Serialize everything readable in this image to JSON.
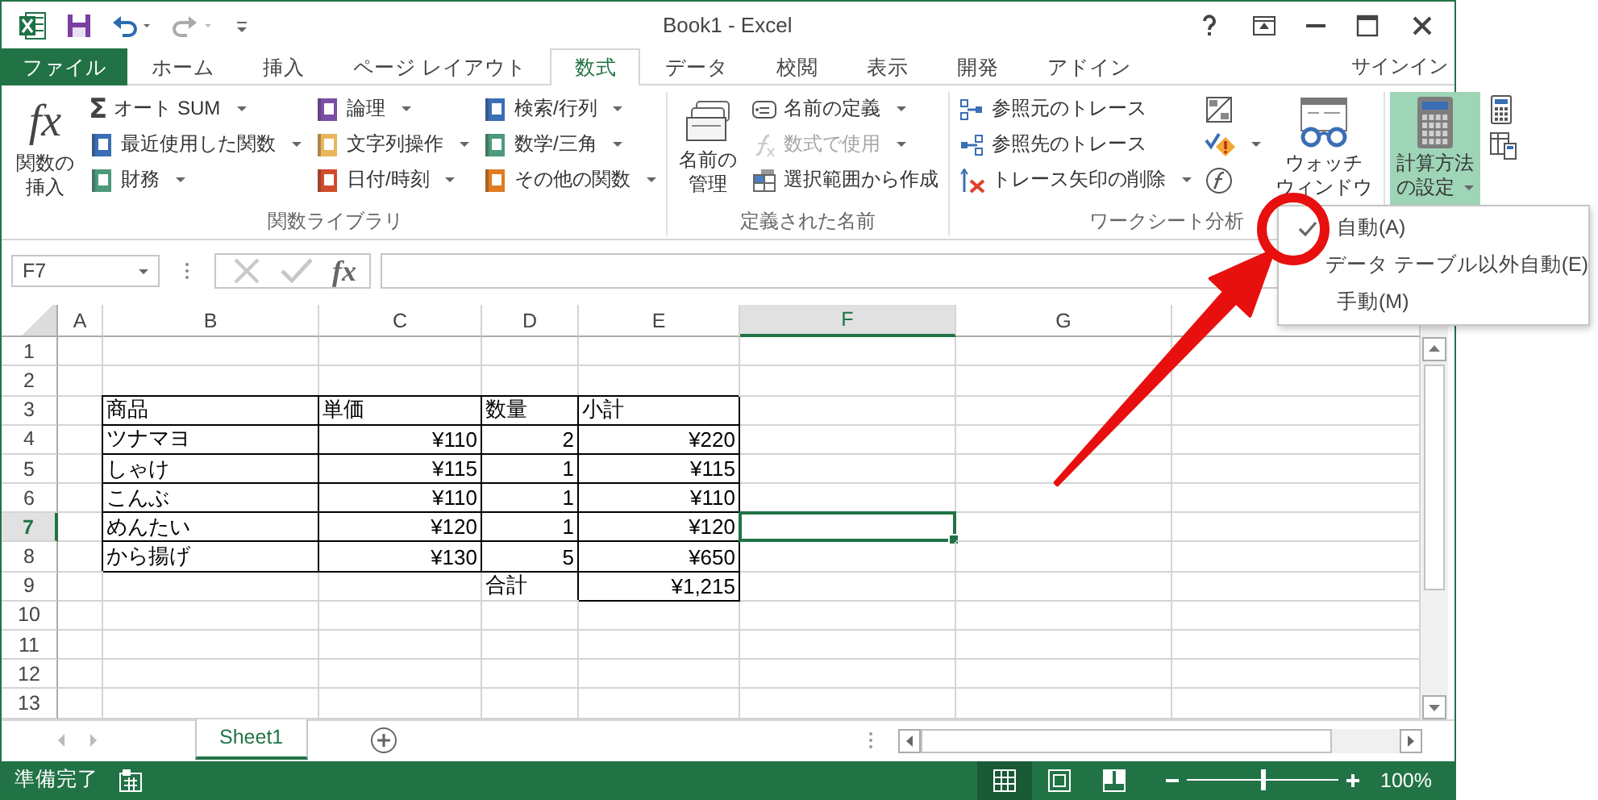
{
  "window": {
    "title": "Book1 - Excel"
  },
  "tabs": [
    {
      "label": "ファイル",
      "kind": "file",
      "selected": false
    },
    {
      "label": "ホーム",
      "kind": "tab",
      "selected": false
    },
    {
      "label": "挿入",
      "kind": "tab",
      "selected": false
    },
    {
      "label": "ページ レイアウト",
      "kind": "tab",
      "selected": false
    },
    {
      "label": "数式",
      "kind": "tab",
      "selected": true
    },
    {
      "label": "データ",
      "kind": "tab",
      "selected": false
    },
    {
      "label": "校閲",
      "kind": "tab",
      "selected": false
    },
    {
      "label": "表示",
      "kind": "tab",
      "selected": false
    },
    {
      "label": "開発",
      "kind": "tab",
      "selected": false
    },
    {
      "label": "アドイン",
      "kind": "tab",
      "selected": false
    }
  ],
  "account": {
    "label": "サインイン"
  },
  "ribbon_groups": [
    {
      "label": "関数ライブラリ",
      "columns": [
        [
          {
            "kind": "large",
            "glyph": "fx",
            "lines": [
              "関数の",
              "挿入"
            ],
            "dropdown": false,
            "disabled": false,
            "pressed": false
          }
        ],
        [
          {
            "kind": "small",
            "glyph": "Σ",
            "label": "オート SUM",
            "dropdown": true,
            "disabled": false
          },
          {
            "kind": "small",
            "label": "最近使用した関数",
            "dropdown": true,
            "disabled": false
          },
          {
            "kind": "small",
            "label": "財務",
            "dropdown": true,
            "disabled": false
          }
        ],
        [
          {
            "kind": "small",
            "label": "論理",
            "dropdown": true,
            "disabled": false
          },
          {
            "kind": "small",
            "label": "文字列操作",
            "dropdown": true,
            "disabled": false
          },
          {
            "kind": "small",
            "label": "日付/時刻",
            "dropdown": true,
            "disabled": false
          }
        ],
        [
          {
            "kind": "small",
            "label": "検索/行列",
            "dropdown": true,
            "disabled": false
          },
          {
            "kind": "small",
            "label": "数学/三角",
            "dropdown": true,
            "disabled": false
          },
          {
            "kind": "small",
            "label": "その他の関数",
            "dropdown": true,
            "disabled": false
          }
        ]
      ]
    },
    {
      "label": "定義された名前",
      "columns": [
        [
          {
            "kind": "large",
            "lines": [
              "名前の",
              "管理"
            ],
            "dropdown": false,
            "disabled": false,
            "pressed": false
          }
        ],
        [
          {
            "kind": "small",
            "label": "名前の定義",
            "dropdown": true,
            "disabled": false
          },
          {
            "kind": "small",
            "label": "数式で使用",
            "dropdown": true,
            "disabled": true
          },
          {
            "kind": "small",
            "label": "選択範囲から作成",
            "dropdown": false,
            "disabled": false
          }
        ]
      ]
    },
    {
      "label": "ワークシート分析",
      "columns": [
        [
          {
            "kind": "small",
            "label": "参照元のトレース",
            "dropdown": false,
            "disabled": false
          },
          {
            "kind": "small",
            "label": "参照先のトレース",
            "dropdown": false,
            "disabled": false
          },
          {
            "kind": "small",
            "label": "トレース矢印の削除",
            "dropdown": true,
            "disabled": false
          }
        ],
        [
          {
            "kind": "icon",
            "dropdown": false,
            "disabled": false
          },
          {
            "kind": "icon",
            "dropdown": true,
            "disabled": false
          },
          {
            "kind": "icon",
            "dropdown": false,
            "disabled": false
          }
        ],
        [
          {
            "kind": "large",
            "lines": [
              "ウォッチ",
              "ウィンドウ"
            ],
            "dropdown": false,
            "disabled": false,
            "pressed": false
          }
        ]
      ]
    },
    {
      "columns": [
        [
          {
            "kind": "large",
            "lines": [
              "計算方法",
              "の設定"
            ],
            "dropdown": true,
            "disabled": false,
            "pressed": true
          }
        ],
        [
          {
            "kind": "icon",
            "dropdown": false,
            "disabled": false
          },
          {
            "kind": "icon",
            "dropdown": false,
            "disabled": false
          }
        ]
      ]
    }
  ],
  "name_box": {
    "value": "F7"
  },
  "formula_bar": {
    "glyph": "fx"
  },
  "sheet": {
    "columns": [
      {
        "label": "A",
        "selected": false
      },
      {
        "label": "B",
        "selected": false
      },
      {
        "label": "C",
        "selected": false
      },
      {
        "label": "D",
        "selected": false
      },
      {
        "label": "E",
        "selected": false
      },
      {
        "label": "F",
        "selected": true
      },
      {
        "label": "G",
        "selected": false
      },
      {
        "selected": false
      }
    ],
    "rows": [
      {
        "label": "1",
        "selected": false
      },
      {
        "label": "2",
        "selected": false
      },
      {
        "label": "3",
        "selected": false,
        "cells": [
          {},
          {
            "text": "商品",
            "kind": "text",
            "bordered": true
          },
          {
            "text": "単価",
            "kind": "text",
            "bordered": true
          },
          {
            "text": "数量",
            "kind": "text",
            "bordered": true
          },
          {
            "text": "小計",
            "kind": "text",
            "bordered": true
          }
        ]
      },
      {
        "label": "4",
        "selected": false,
        "cells": [
          {},
          {
            "text": "ツナマヨ",
            "kind": "text",
            "bordered": true
          },
          {
            "text": "¥110",
            "kind": "number",
            "bordered": true
          },
          {
            "text": "2",
            "kind": "number",
            "bordered": true
          },
          {
            "text": "¥220",
            "kind": "number",
            "bordered": true
          }
        ]
      },
      {
        "label": "5",
        "selected": false,
        "cells": [
          {},
          {
            "text": "しゃけ",
            "kind": "text",
            "bordered": true
          },
          {
            "text": "¥115",
            "kind": "number",
            "bordered": true
          },
          {
            "text": "1",
            "kind": "number",
            "bordered": true
          },
          {
            "text": "¥115",
            "kind": "number",
            "bordered": true
          }
        ]
      },
      {
        "label": "6",
        "selected": false,
        "cells": [
          {},
          {
            "text": "こんぶ",
            "kind": "text",
            "bordered": true
          },
          {
            "text": "¥110",
            "kind": "number",
            "bordered": true
          },
          {
            "text": "1",
            "kind": "number",
            "bordered": true
          },
          {
            "text": "¥110",
            "kind": "number",
            "bordered": true
          }
        ]
      },
      {
        "label": "7",
        "selected": true,
        "cells": [
          {},
          {
            "text": "めんたい",
            "kind": "text",
            "bordered": true
          },
          {
            "text": "¥120",
            "kind": "number",
            "bordered": true
          },
          {
            "text": "1",
            "kind": "number",
            "bordered": true
          },
          {
            "text": "¥120",
            "kind": "number",
            "bordered": true
          }
        ]
      },
      {
        "label": "8",
        "selected": false,
        "cells": [
          {},
          {
            "text": "から揚げ",
            "kind": "text",
            "bordered": true
          },
          {
            "text": "¥130",
            "kind": "number",
            "bordered": true
          },
          {
            "text": "5",
            "kind": "number",
            "bordered": true
          },
          {
            "text": "¥650",
            "kind": "number",
            "bordered": true
          }
        ]
      },
      {
        "label": "9",
        "selected": false,
        "cells": [
          {},
          {},
          {},
          {
            "text": "合計",
            "kind": "text",
            "bordered": false
          },
          {
            "text": "¥1,215",
            "kind": "number",
            "bordered": true
          }
        ]
      },
      {
        "label": "10",
        "selected": false
      },
      {
        "label": "11",
        "selected": false
      },
      {
        "label": "12",
        "selected": false
      },
      {
        "label": "13",
        "selected": false
      }
    ]
  },
  "sheet_tabs": [
    {
      "label": "Sheet1",
      "selected": true
    }
  ],
  "status_bar": {
    "label": "準備完了",
    "views": [
      {
        "selected": true
      },
      {
        "selected": false
      },
      {
        "selected": false
      }
    ],
    "zoom": {
      "level": 0.5,
      "reading": "100%"
    }
  },
  "calc_menu": {
    "items": [
      {
        "label": "自動(A)",
        "checked": true
      },
      {
        "label": "データ テーブル以外自動(E)",
        "checked": false
      },
      {
        "label": "手動(M)",
        "checked": false
      }
    ]
  }
}
